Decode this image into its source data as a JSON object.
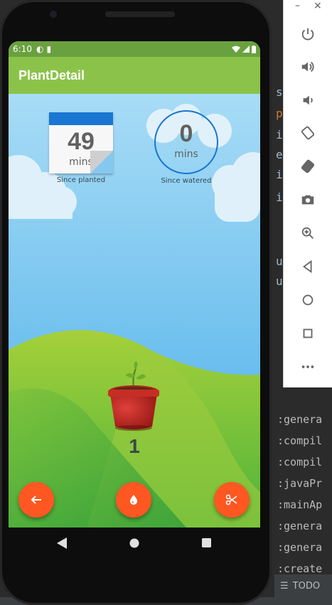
{
  "ide": {
    "code_lines": [
      "s",
      "p",
      "i",
      "e",
      "i",
      "i",
      "u",
      "u"
    ],
    "log_lines": [
      ":genera",
      ":compil",
      ":compil",
      ":javaPr",
      ":mainAp",
      ":genera",
      ":genera",
      ":create"
    ],
    "status_todo": "TODO",
    "window_minimize": "–",
    "window_close": "×"
  },
  "emulator_toolbar": {
    "buttons": [
      "power-icon",
      "volume-up-icon",
      "volume-down-icon",
      "rotate-left-icon",
      "rotate-right-icon",
      "camera-icon",
      "zoom-icon",
      "back-icon",
      "home-icon",
      "overview-icon",
      "more-icon"
    ]
  },
  "statusbar": {
    "time": "6:10"
  },
  "app": {
    "title": "PlantDetail"
  },
  "plant": {
    "since_planted_value": "49",
    "since_planted_unit": "mins",
    "since_planted_caption": "Since planted",
    "since_watered_value": "0",
    "since_watered_unit": "mins",
    "since_watered_caption": "Since watered",
    "count": "1"
  },
  "colors": {
    "appbar": "#8bc34a",
    "statusbar": "#6aa13f",
    "accent": "#1976d2",
    "fab": "#ff5722"
  }
}
